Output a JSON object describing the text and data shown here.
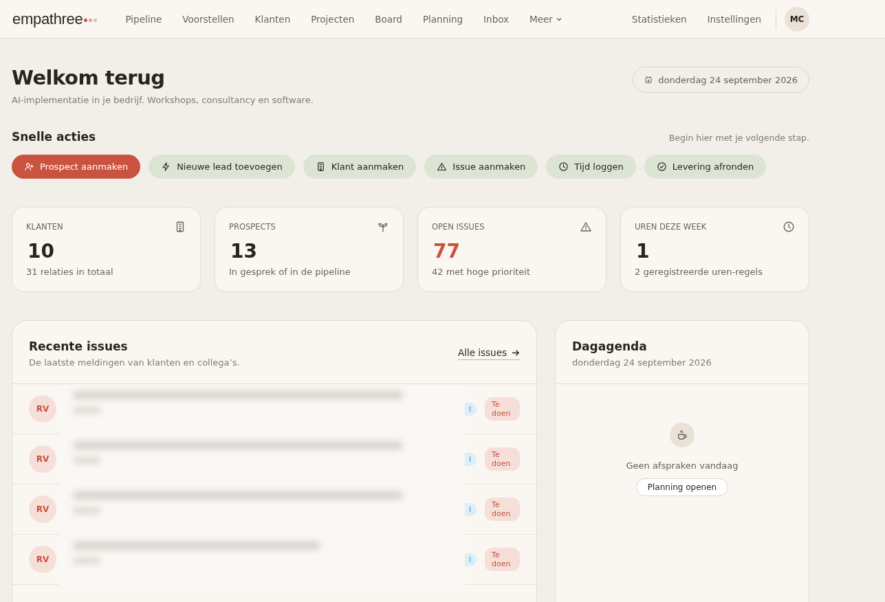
{
  "nav": {
    "logo": "empathree",
    "items": [
      "Pipeline",
      "Voorstellen",
      "Klanten",
      "Projecten",
      "Board",
      "Planning",
      "Inbox"
    ],
    "more": "Meer",
    "right_items": [
      "Statistieken",
      "Instellingen"
    ],
    "avatar": "MC"
  },
  "header": {
    "title": "Welkom terug",
    "subtitle": "AI-implementatie in je bedrijf. Workshops, consultancy en software.",
    "date": "donderdag 24 september 2026"
  },
  "quick_actions": {
    "title": "Snelle acties",
    "hint": "Begin hier met je volgende stap.",
    "actions": [
      {
        "label": "Prospect aanmaken",
        "kind": "user-plus",
        "primary": true
      },
      {
        "label": "Nieuwe lead toevoegen",
        "kind": "bolt",
        "primary": false
      },
      {
        "label": "Klant aanmaken",
        "kind": "building",
        "primary": false
      },
      {
        "label": "Issue aanmaken",
        "kind": "warning",
        "primary": false
      },
      {
        "label": "Tijd loggen",
        "kind": "clock",
        "primary": false
      },
      {
        "label": "Levering afronden",
        "kind": "check",
        "primary": false
      }
    ]
  },
  "stats": [
    {
      "label": "KLANTEN",
      "value": "10",
      "note": "31 relaties in totaal",
      "kind": "building",
      "alert": false
    },
    {
      "label": "PROSPECTS",
      "value": "13",
      "note": "In gesprek of in de pipeline",
      "kind": "sprout",
      "alert": false
    },
    {
      "label": "OPEN ISSUES",
      "value": "77",
      "note": "42 met hoge prioriteit",
      "kind": "warning",
      "alert": true
    },
    {
      "label": "UREN DEZE WEEK",
      "value": "1",
      "note": "2 geregistreerde uren-regels",
      "kind": "clock",
      "alert": false
    }
  ],
  "issues": {
    "title": "Recente issues",
    "subtitle": "De laatste meldingen van klanten en collega’s.",
    "link": "Alle issues",
    "rows": [
      {
        "initials": "RV",
        "type_badge": "l",
        "status": "Te doen"
      },
      {
        "initials": "RV",
        "type_badge": "l",
        "status": "Te doen"
      },
      {
        "initials": "RV",
        "type_badge": "l",
        "status": "Te doen"
      },
      {
        "initials": "RV",
        "type_badge": "l",
        "status": "Te doen"
      }
    ]
  },
  "agenda": {
    "title": "Dagagenda",
    "date": "donderdag 24 september 2026",
    "empty": "Geen afspraken vandaag",
    "button": "Planning openen"
  }
}
